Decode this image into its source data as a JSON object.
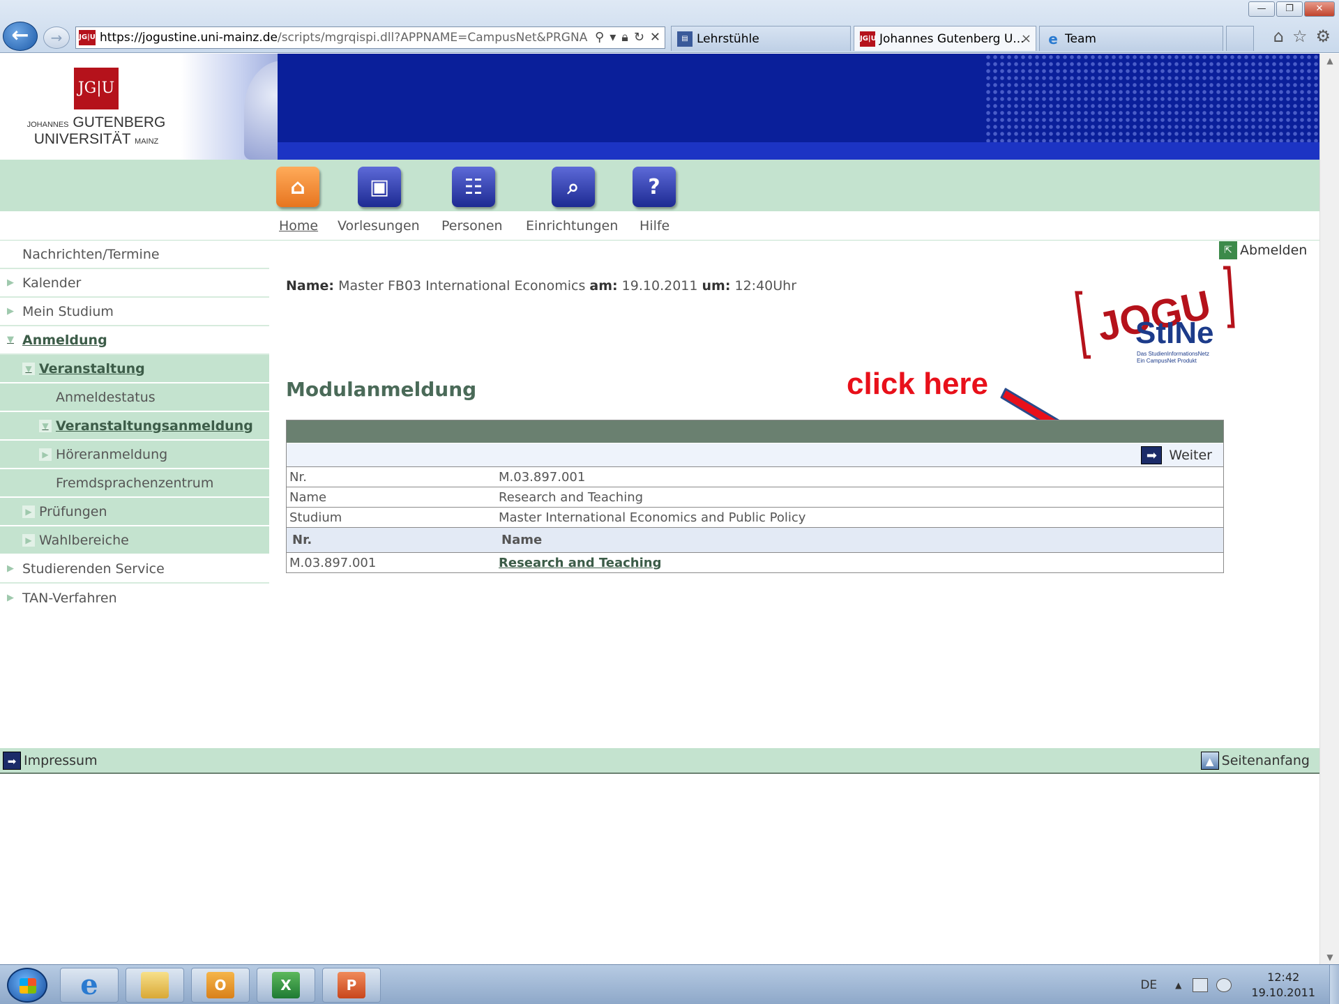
{
  "browser": {
    "url_host": "https://jogustine.uni-mainz.de",
    "url_path": "/scripts/mgrqispi.dll?APPNAME=CampusNet&PRGNA",
    "tabs": [
      {
        "label": "Lehrstühle",
        "active": false
      },
      {
        "label": "Johannes Gutenberg U...",
        "active": true
      },
      {
        "label": "Team",
        "active": false
      }
    ],
    "site_icon": "JG|U"
  },
  "header": {
    "logo_mark": "JG|U",
    "logo_line1_small": "JOHANNES",
    "logo_line1": "GUTENBERG",
    "logo_line2": "UNIVERSITÄT",
    "logo_line2_small": "MAINZ"
  },
  "nav": {
    "items": [
      {
        "label": "Home",
        "icon": "home-icon",
        "current": true
      },
      {
        "label": "Vorlesungen",
        "icon": "lecture-icon",
        "current": false
      },
      {
        "label": "Personen",
        "icon": "people-icon",
        "current": false
      },
      {
        "label": "Einrichtungen",
        "icon": "search-building-icon",
        "current": false
      },
      {
        "label": "Hilfe",
        "icon": "help-icon",
        "current": false
      }
    ]
  },
  "sidebar": {
    "items": [
      {
        "label": "Nachrichten/Termine"
      },
      {
        "label": "Kalender"
      },
      {
        "label": "Mein Studium"
      },
      {
        "label": "Anmeldung"
      },
      {
        "label": "Veranstaltung"
      },
      {
        "label": "Anmeldestatus"
      },
      {
        "label": "Veranstaltungsanmeldung"
      },
      {
        "label": "Höreranmeldung"
      },
      {
        "label": "Fremdsprachenzentrum"
      },
      {
        "label": "Prüfungen"
      },
      {
        "label": "Wahlbereiche"
      },
      {
        "label": "Studierenden Service"
      },
      {
        "label": "TAN-Verfahren"
      }
    ]
  },
  "main": {
    "logout_label": "Abmelden",
    "info": {
      "name_label": "Name:",
      "name_value": "Master FB03 International Economics",
      "am_label": "am:",
      "date_value": "19.10.2011",
      "um_label": "um:",
      "time_value": "12:40Uhr"
    },
    "stine_logo": {
      "bracket_text": "JOGU",
      "brand": "StINe",
      "tagline1": "Das StudienInformationsNetz",
      "tagline2": "Ein CampusNet Produkt"
    },
    "section_title": "Modulanmeldung",
    "annotation": "click here",
    "weiter_label": "Weiter",
    "details": [
      {
        "label": "Nr.",
        "value": "M.03.897.001"
      },
      {
        "label": "Name",
        "value": "Research and Teaching"
      },
      {
        "label": "Studium",
        "value": "Master International Economics and Public Policy"
      }
    ],
    "modules_header": {
      "col1": "Nr.",
      "col2": "Name"
    },
    "modules": [
      {
        "nr": "M.03.897.001",
        "name": "Research and Teaching"
      }
    ]
  },
  "footer": {
    "impressum_label": "Impressum",
    "top_label": "Seitenanfang"
  },
  "taskbar": {
    "language": "DE",
    "time": "12:42",
    "date": "19.10.2011"
  },
  "colors": {
    "accent_green": "#c4e3cf",
    "banner_blue": "#0a1f9a",
    "table_header": "#6a8070",
    "annotation_red": "#e8101a",
    "brand_red": "#b5121b"
  }
}
